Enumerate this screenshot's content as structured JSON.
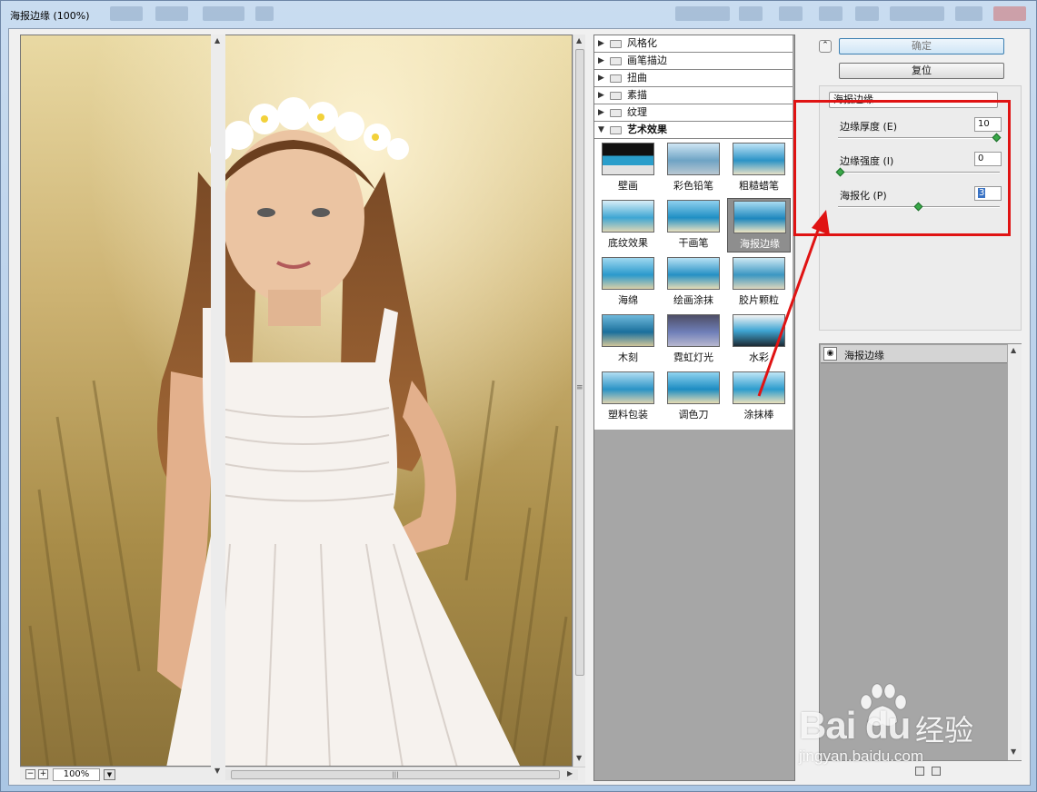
{
  "window": {
    "title": "海报边缘 (100%)"
  },
  "preview": {
    "zoom": "100%"
  },
  "categories": [
    {
      "label": "风格化",
      "open": false
    },
    {
      "label": "画笔描边",
      "open": false
    },
    {
      "label": "扭曲",
      "open": false
    },
    {
      "label": "素描",
      "open": false
    },
    {
      "label": "纹理",
      "open": false
    },
    {
      "label": "艺术效果",
      "open": true
    }
  ],
  "filters": [
    {
      "label": "壁画"
    },
    {
      "label": "彩色铅笔"
    },
    {
      "label": "粗糙蜡笔"
    },
    {
      "label": "底纹效果"
    },
    {
      "label": "干画笔"
    },
    {
      "label": "海报边缘",
      "selected": true
    },
    {
      "label": "海绵"
    },
    {
      "label": "绘画涂抹"
    },
    {
      "label": "胶片颗粒"
    },
    {
      "label": "木刻"
    },
    {
      "label": "霓虹灯光"
    },
    {
      "label": "水彩"
    },
    {
      "label": "塑料包装"
    },
    {
      "label": "调色刀"
    },
    {
      "label": "涂抹棒"
    }
  ],
  "buttons": {
    "ok": "确定",
    "reset": "复位"
  },
  "settings": {
    "filter_name": "海报边缘",
    "params": [
      {
        "label": "边缘厚度 (E)",
        "value": "10",
        "level": 1.0
      },
      {
        "label": "边缘强度 (I)",
        "value": "0",
        "level": 0.0
      },
      {
        "label": "海报化 (P)",
        "value": "3",
        "level": 0.5
      }
    ]
  },
  "layers": [
    {
      "label": "海报边缘"
    }
  ],
  "watermark": {
    "brand": "Bai du",
    "cn": "经验",
    "url": "jingyan.baidu.com"
  },
  "colors": {
    "annotation": "#e01313",
    "slider_knob": "#39a848",
    "selection": "#3a73c4"
  }
}
